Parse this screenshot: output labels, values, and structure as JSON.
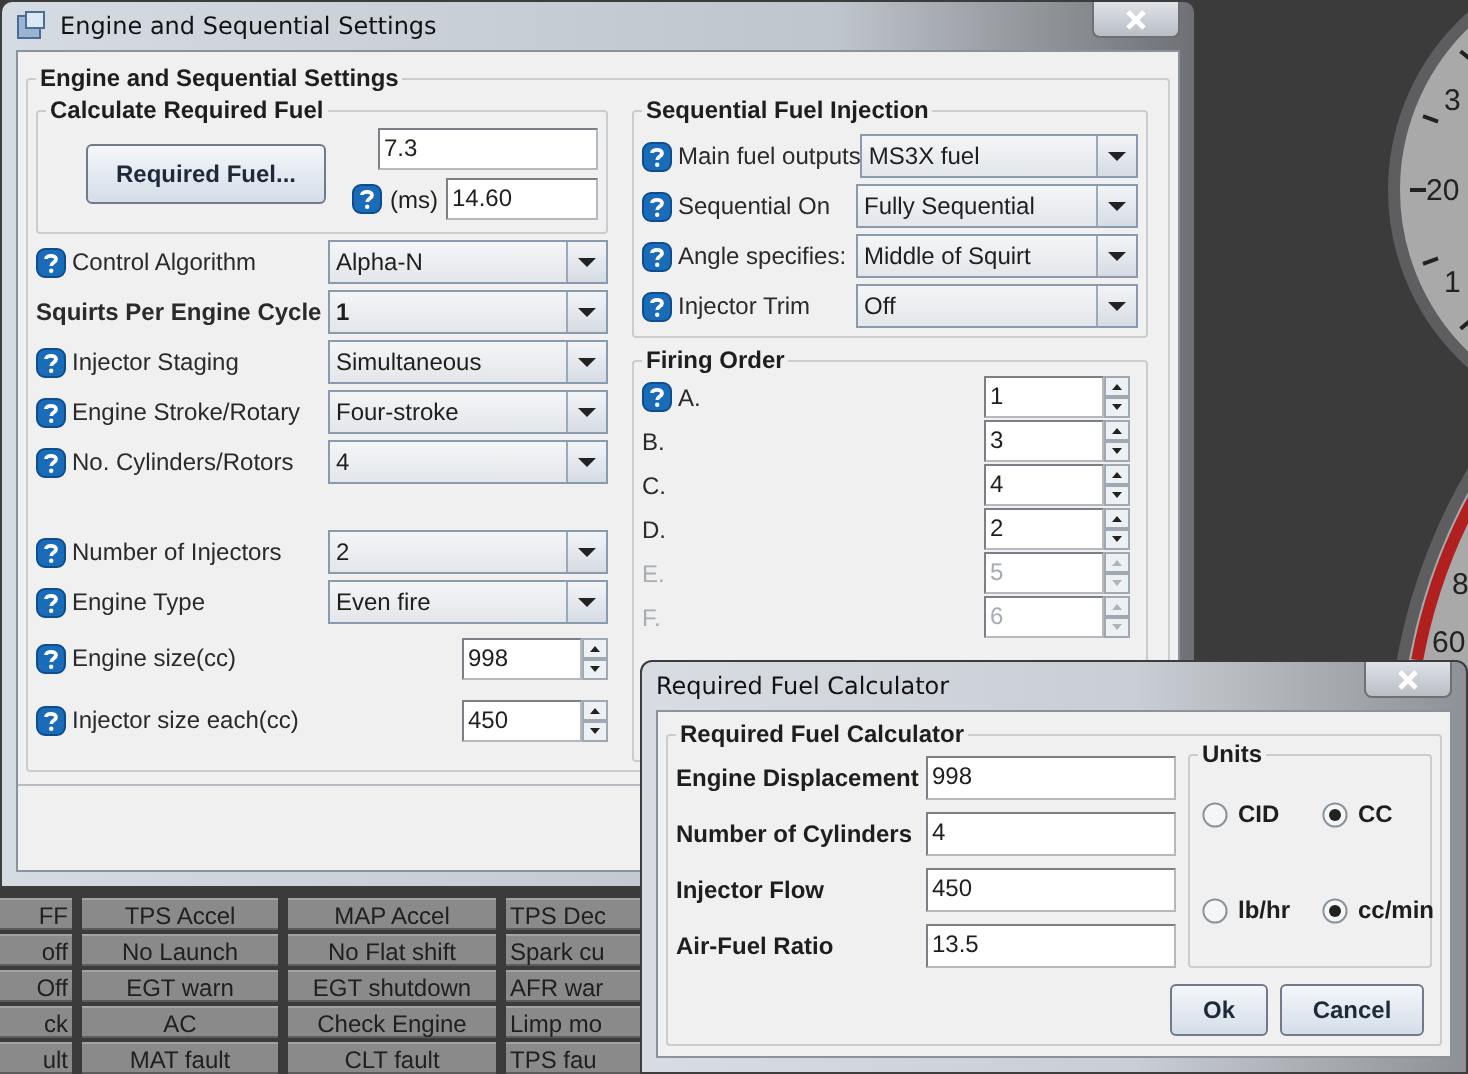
{
  "gauges": [
    {
      "labels": [
        "3",
        "20",
        "1"
      ],
      "redline": false
    },
    {
      "labels": [
        "8",
        "60"
      ],
      "redline": true
    }
  ],
  "indicators": [
    [
      "FF",
      "TPS Accel",
      "MAP Accel",
      "TPS Dec"
    ],
    [
      "off",
      "No Launch",
      "No Flat shift",
      "Spark cu"
    ],
    [
      "Off",
      "EGT warn",
      "EGT shutdown",
      "AFR war"
    ],
    [
      "ck",
      "AC",
      "Check Engine",
      "Limp mo"
    ],
    [
      "ult",
      "MAT fault",
      "CLT fault",
      "TPS fau"
    ]
  ],
  "main_window": {
    "title": "Engine and Sequential Settings",
    "group_title": "Engine and Sequential Settings",
    "required_fuel": {
      "title": "Calculate Required Fuel",
      "button": "Required Fuel...",
      "value": "7.3",
      "unit": "(ms)",
      "ms_value": "14.60"
    },
    "engine_rows": [
      {
        "kind": "combo",
        "label": "Control Algorithm",
        "value": "Alpha-N",
        "help": true,
        "bold": false
      },
      {
        "kind": "combo",
        "label": "Squirts Per Engine Cycle",
        "value": "1",
        "help": false,
        "bold": true
      },
      {
        "kind": "combo",
        "label": "Injector Staging",
        "value": "Simultaneous",
        "help": true,
        "bold": false
      },
      {
        "kind": "combo",
        "label": "Engine Stroke/Rotary",
        "value": "Four-stroke",
        "help": true,
        "bold": false
      },
      {
        "kind": "combo",
        "label": "No. Cylinders/Rotors",
        "value": "4",
        "help": true,
        "bold": false
      }
    ],
    "injector_rows": [
      {
        "kind": "combo",
        "label": "Number of Injectors",
        "value": "2",
        "help": true,
        "bold": false
      },
      {
        "kind": "combo",
        "label": "Engine Type",
        "value": "Even fire",
        "help": true,
        "bold": false
      },
      {
        "kind": "spinner",
        "label": "Engine size(cc)",
        "value": "998",
        "help": true,
        "bold": false
      },
      {
        "kind": "spinner",
        "label": "Injector size each(cc)",
        "value": "450",
        "help": true,
        "bold": false
      }
    ],
    "sequential": {
      "title": "Sequential Fuel Injection",
      "rows": [
        {
          "label": "Main fuel outputs",
          "value": "MS3X fuel",
          "help": true
        },
        {
          "label": "Sequential On",
          "value": "Fully Sequential",
          "help": true
        },
        {
          "label": "Angle specifies:",
          "value": "Middle of Squirt",
          "help": true
        },
        {
          "label": "Injector Trim",
          "value": "Off",
          "help": true
        }
      ]
    },
    "firing_order": {
      "title": "Firing Order",
      "rows": [
        {
          "label": "A.",
          "value": "1",
          "help": true,
          "disabled": false
        },
        {
          "label": "B.",
          "value": "3",
          "help": false,
          "disabled": false
        },
        {
          "label": "C.",
          "value": "4",
          "help": false,
          "disabled": false
        },
        {
          "label": "D.",
          "value": "2",
          "help": false,
          "disabled": false
        },
        {
          "label": "E.",
          "value": "5",
          "help": false,
          "disabled": true
        },
        {
          "label": "F.",
          "value": "6",
          "help": false,
          "disabled": true
        }
      ]
    }
  },
  "dialog": {
    "title": "Required Fuel Calculator",
    "group_title": "Required Fuel Calculator",
    "fields": [
      {
        "label": "Engine Displacement",
        "value": "998"
      },
      {
        "label": "Number of Cylinders",
        "value": "4"
      },
      {
        "label": "Injector Flow",
        "value": "450"
      },
      {
        "label": "Air-Fuel Ratio",
        "value": "13.5"
      }
    ],
    "units": {
      "title": "Units",
      "options": [
        {
          "label": "CID",
          "selected": false
        },
        {
          "label": "CC",
          "selected": true
        },
        {
          "label": "lb/hr",
          "selected": false
        },
        {
          "label": "cc/min",
          "selected": true
        }
      ]
    },
    "buttons": [
      "Ok",
      "Cancel"
    ]
  }
}
